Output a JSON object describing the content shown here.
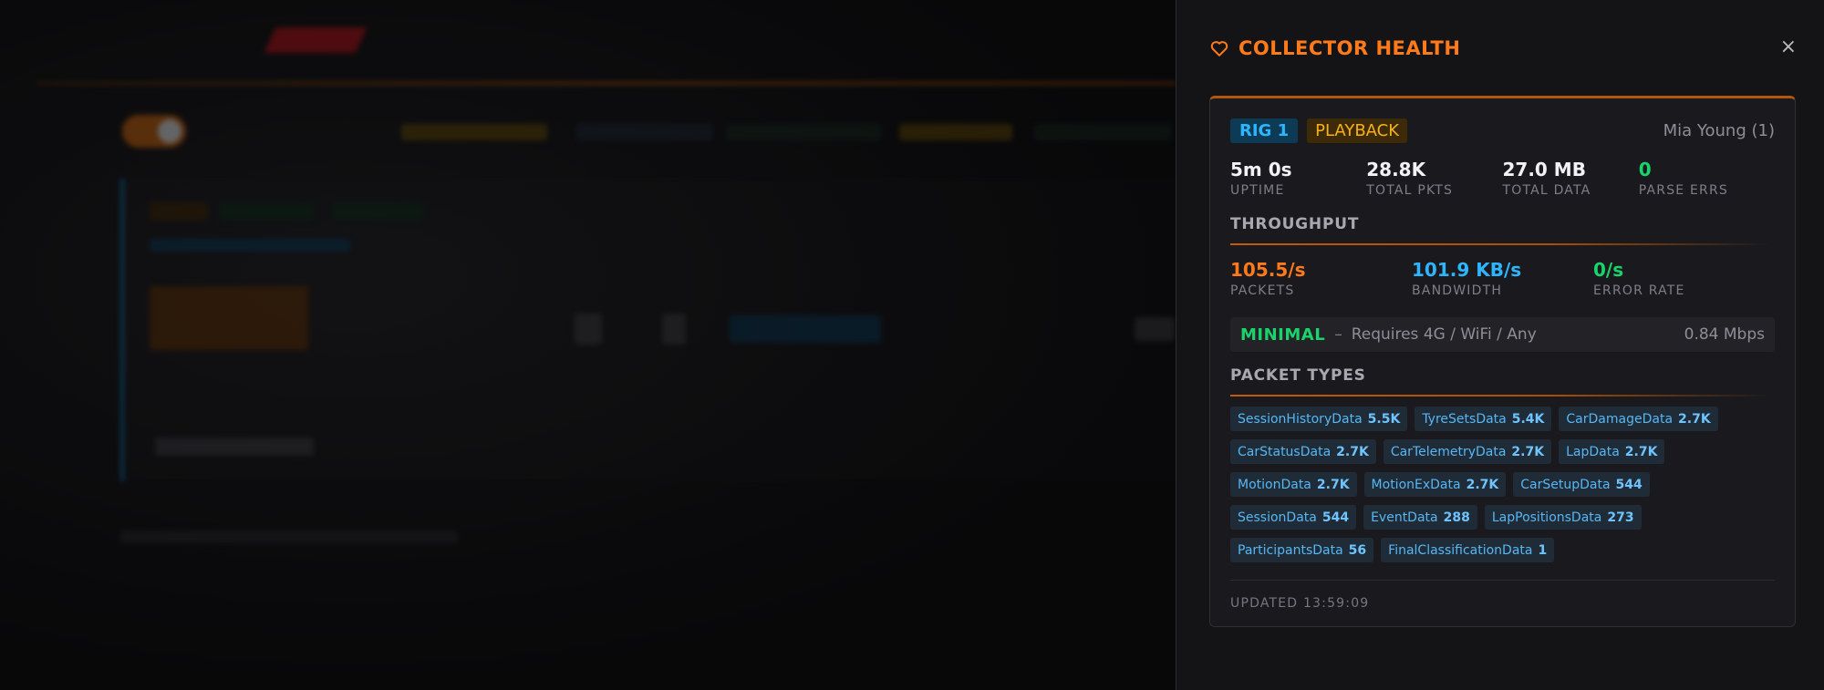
{
  "panel": {
    "title": "COLLECTOR HEALTH",
    "close_glyph": "×",
    "rig_badge": "RIG 1",
    "mode_badge": "PLAYBACK",
    "driver": "Mia Young (1)",
    "stats": [
      {
        "value": "5m 0s",
        "label": "UPTIME"
      },
      {
        "value": "28.8K",
        "label": "TOTAL PKTS"
      },
      {
        "value": "27.0 MB",
        "label": "TOTAL DATA"
      },
      {
        "value": "0",
        "label": "PARSE ERRS"
      }
    ],
    "throughput": {
      "title": "THROUGHPUT",
      "items": [
        {
          "value": "105.5/s",
          "label": "PACKETS",
          "color": "#ff7a1a"
        },
        {
          "value": "101.9 KB/s",
          "label": "BANDWIDTH",
          "color": "#2fb4ff"
        },
        {
          "value": "0/s",
          "label": "ERROR RATE",
          "color": "#19d46a"
        }
      ]
    },
    "network": {
      "tier": "MINIMAL",
      "dash": "–",
      "requirement": "Requires 4G / WiFi / Any",
      "speed": "0.84 Mbps"
    },
    "packet_types": {
      "title": "PACKET TYPES",
      "rows": [
        [
          {
            "name": "SessionHistoryData",
            "count": "5.5K"
          },
          {
            "name": "TyreSetsData",
            "count": "5.4K"
          },
          {
            "name": "CarDamageData",
            "count": "2.7K"
          }
        ],
        [
          {
            "name": "CarStatusData",
            "count": "2.7K"
          },
          {
            "name": "CarTelemetryData",
            "count": "2.7K"
          },
          {
            "name": "LapData",
            "count": "2.7K"
          }
        ],
        [
          {
            "name": "MotionData",
            "count": "2.7K"
          },
          {
            "name": "MotionExData",
            "count": "2.7K"
          },
          {
            "name": "CarSetupData",
            "count": "544"
          }
        ],
        [
          {
            "name": "SessionData",
            "count": "544"
          },
          {
            "name": "EventData",
            "count": "288"
          },
          {
            "name": "LapPositionsData",
            "count": "273"
          }
        ],
        [
          {
            "name": "ParticipantsData",
            "count": "56"
          },
          {
            "name": "FinalClassificationData",
            "count": "1"
          }
        ]
      ]
    },
    "updated": "UPDATED 13:59:09"
  },
  "colors": {
    "accent": "#ff7a1a",
    "blue": "#2fb4ff",
    "green": "#19d46a",
    "amber": "#f7b21a"
  }
}
